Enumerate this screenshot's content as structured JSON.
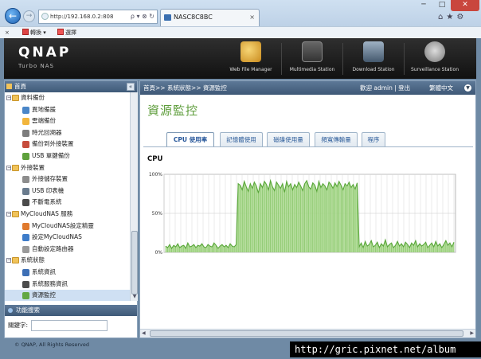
{
  "browser": {
    "address": "http://192.168.0.2:808",
    "address_tools": "ρ ▾ ⊗ ↻",
    "tab_title": "NASC8C8BC",
    "tab_close": "×",
    "back": "←",
    "forward": "→",
    "win_min": "─",
    "win_max": "□",
    "win_close": "✕",
    "right_icons": "⌂★⚙",
    "cmd_close": "×",
    "cmd_convert": "轉換",
    "cmd_select": "選擇"
  },
  "header": {
    "logo": "QNAP",
    "subtitle": "Turbo NAS",
    "apps": [
      {
        "label": "Web File Manager",
        "icon": "folder-magnifier-icon"
      },
      {
        "label": "Multimedia Station",
        "icon": "film-icon"
      },
      {
        "label": "Download Station",
        "icon": "download-station-icon"
      },
      {
        "label": "Surveillance Station",
        "icon": "camera-icon"
      }
    ]
  },
  "sidebar": {
    "title": "首頁",
    "collapse": "«",
    "tree": [
      {
        "type": "folder",
        "label": "資料備份"
      },
      {
        "type": "leaf",
        "label": "異地備援",
        "color": "#4a86c8"
      },
      {
        "type": "leaf",
        "label": "雲端備份",
        "color": "#f2b53c"
      },
      {
        "type": "leaf",
        "label": "時光回溯器",
        "color": "#7d7d7d"
      },
      {
        "type": "leaf",
        "label": "備份到外接裝置",
        "color": "#c64c3c"
      },
      {
        "type": "leaf",
        "label": "USB 單鍵備份",
        "color": "#5ea13c"
      },
      {
        "type": "folder",
        "label": "外接裝置"
      },
      {
        "type": "leaf",
        "label": "外接儲存裝置",
        "color": "#8d8d8d"
      },
      {
        "type": "leaf",
        "label": "USB 印表機",
        "color": "#6a7c8e"
      },
      {
        "type": "leaf",
        "label": "不斷電系統",
        "color": "#4b4b4b"
      },
      {
        "type": "folder",
        "label": "MyCloudNAS 服務"
      },
      {
        "type": "leaf",
        "label": "MyCloudNAS設定精靈",
        "color": "#e07a2e"
      },
      {
        "type": "leaf",
        "label": "設定MyCloudNAS",
        "color": "#3d7cc9"
      },
      {
        "type": "leaf",
        "label": "自動設定路由器",
        "color": "#9a9a9a"
      },
      {
        "type": "folder",
        "label": "系統狀態"
      },
      {
        "type": "leaf",
        "label": "系統資訊",
        "color": "#3d6fb5"
      },
      {
        "type": "leaf",
        "label": "系統服務資訊",
        "color": "#4c4c4c"
      },
      {
        "type": "leaf",
        "label": "資源監控",
        "color": "#63a843",
        "selected": true
      }
    ],
    "search_title": "功能搜索",
    "keyword_label": "關鍵字:",
    "keyword_value": ""
  },
  "footer": {
    "copyright": "© QNAP, All Rights Reserved",
    "watermark": "http://gric.pixnet.net/album"
  },
  "main": {
    "breadcrumb": "首頁>> 系統狀態>> 資源監控",
    "welcome": "歡迎 admin | 登出",
    "language": "繁體中文",
    "title": "資源監控",
    "tabs": [
      "CPU 使用率",
      "記憶體使用",
      "磁碟使用量",
      "頻寬傳輸量",
      "程序"
    ],
    "active_tab": 0,
    "section_label": "CPU"
  },
  "chart_data": {
    "type": "area",
    "title": "CPU",
    "xlabel": "",
    "ylabel": "",
    "ylim": [
      0,
      100
    ],
    "yticks": [
      "0%",
      "50%",
      "100%"
    ],
    "grid": true,
    "color": "#5aa73a",
    "fill": "#a9d88d",
    "series": [
      {
        "values": [
          8,
          6,
          10,
          5,
          9,
          7,
          11,
          6,
          8,
          9,
          5,
          12,
          7,
          8,
          10,
          6,
          9,
          8,
          11,
          7,
          6,
          10,
          8,
          7,
          12,
          9,
          5,
          8,
          10,
          7,
          9,
          6,
          11,
          8,
          7,
          10,
          88,
          86,
          80,
          91,
          84,
          78,
          88,
          82,
          90,
          85,
          76,
          88,
          83,
          91,
          87,
          80,
          92,
          84,
          79,
          90,
          86,
          82,
          88,
          77,
          91,
          84,
          88,
          80,
          87,
          83,
          90,
          85,
          79,
          88,
          92,
          84,
          81,
          89,
          86,
          78,
          91,
          83,
          88,
          85,
          80,
          90,
          87,
          82,
          89,
          84,
          91,
          86,
          80,
          88,
          85,
          90,
          83,
          87,
          81,
          89,
          7,
          12,
          6,
          14,
          8,
          10,
          15,
          7,
          9,
          13,
          6,
          11,
          8,
          16,
          7,
          10,
          12,
          6,
          9,
          14,
          8,
          11,
          7,
          13,
          10,
          6,
          12,
          9,
          15,
          7,
          11,
          8,
          10,
          13,
          6,
          9,
          12,
          7,
          14,
          8,
          11,
          6,
          10,
          15,
          9,
          12,
          7,
          13
        ]
      }
    ]
  }
}
